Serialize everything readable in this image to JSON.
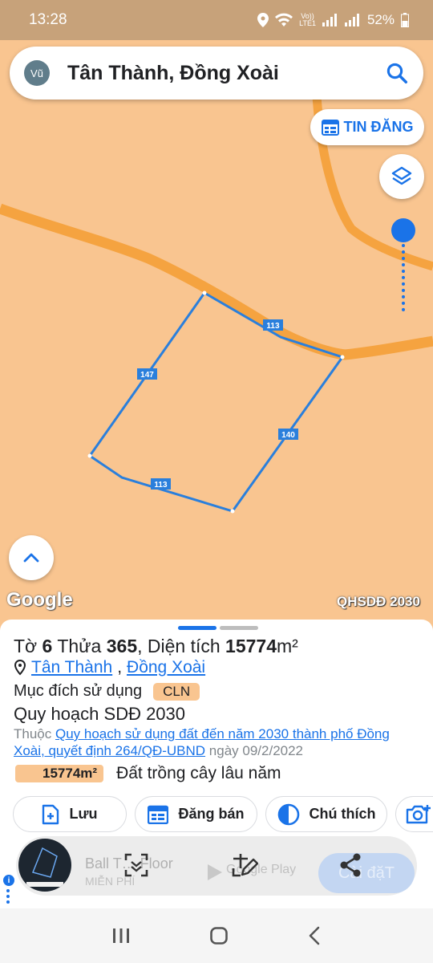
{
  "status_bar": {
    "time": "13:28",
    "volte_top": "Vo))",
    "volte_bottom": "LTE1",
    "battery": "52%"
  },
  "search": {
    "avatar": "Vũ",
    "query": "Tân Thành, Đồng Xoài"
  },
  "map": {
    "tin_dang_label": "TIN ĐĂNG",
    "google_label": "Google",
    "layer_label": "QHSDĐ 2030",
    "edge_labels": [
      "113",
      "147",
      "140",
      "113"
    ]
  },
  "parcel": {
    "to_label": "Tờ",
    "to_value": "6",
    "thua_label": "Thửa",
    "thua_value": "365",
    "area_label": "Diện tích",
    "area_value": "15774",
    "area_unit": "m²",
    "ward": "Tân Thành",
    "city": "Đồng Xoài",
    "purpose_label": "Mục đích sử dụng",
    "purpose_code": "CLN",
    "plan_title": "Quy hoạch SDĐ 2030",
    "plan_prefix": "Thuộc",
    "plan_link": "Quy hoạch sử dụng đất đến năm 2030 thành phố Đồng Xoài, quyết định 264/QĐ-UBND",
    "plan_date": "ngày 09/2/2022",
    "area_badge": "15774m²",
    "land_type": "Đất trồng cây lâu năm"
  },
  "actions": [
    {
      "label": "Lưu"
    },
    {
      "label": "Đăng bán"
    },
    {
      "label": "Chú thích"
    }
  ],
  "ad": {
    "title": "Ball T… Floor",
    "subtitle": "MIỄN PHÍ",
    "store": "Google Play",
    "cta": "Cài đặT"
  },
  "colors": {
    "accent": "#1a73e8",
    "map_bg": "#f9c590",
    "road": "#f5a340"
  }
}
